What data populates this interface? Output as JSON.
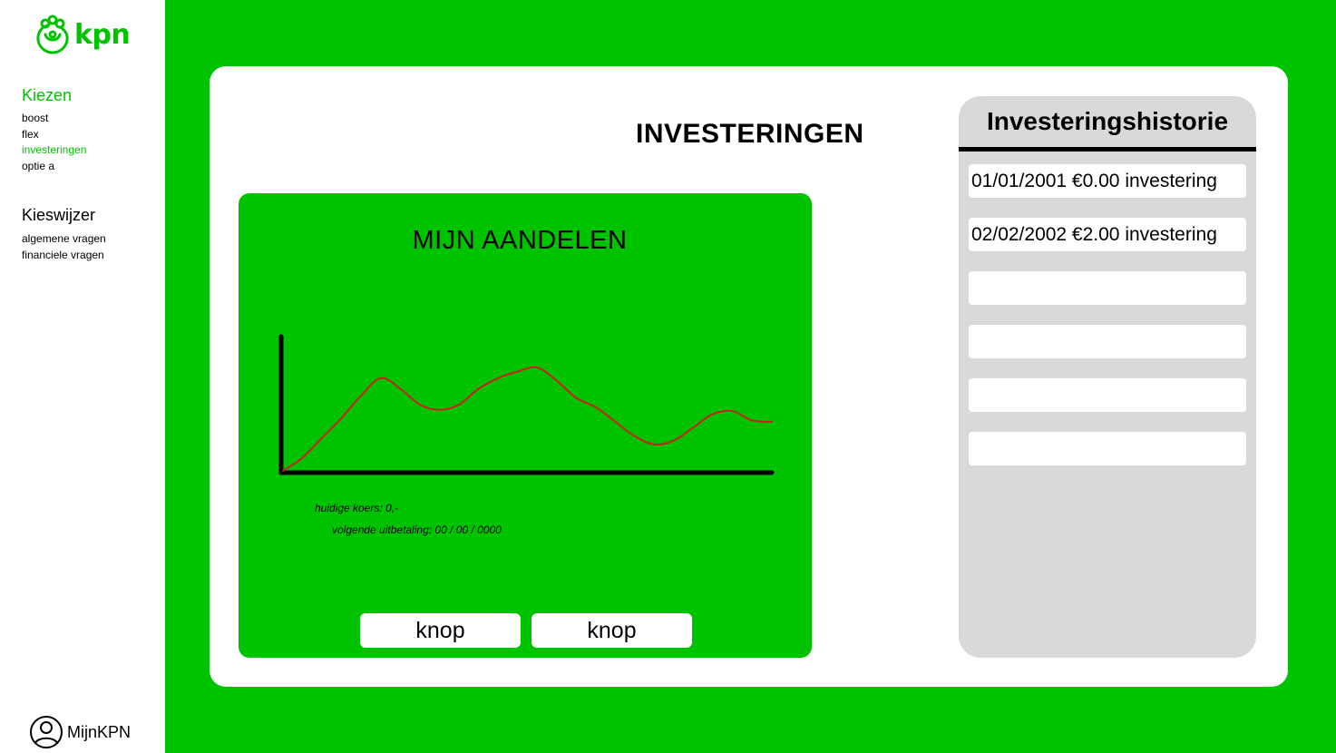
{
  "brand": {
    "name": "kpn",
    "color": "#00c300"
  },
  "sidebar": {
    "sections": [
      {
        "heading": "Kiezen",
        "items": [
          {
            "label": "boost",
            "active": false
          },
          {
            "label": "flex",
            "active": false
          },
          {
            "label": "investeringen",
            "active": true
          },
          {
            "label": "optie a",
            "active": false
          }
        ]
      },
      {
        "heading": "Kieswijzer",
        "items": [
          {
            "label": "algemene vragen",
            "active": false
          },
          {
            "label": "financiele vragen",
            "active": false
          }
        ]
      }
    ],
    "account_label": "MijnKPN"
  },
  "main": {
    "title": "INVESTERINGEN",
    "stocks": {
      "title": "MIJN AANDELEN",
      "current_rate": "huidige koers: 0,-",
      "next_payout": "volgende uitbetaling: 00 / 00 / 0000",
      "buttons": [
        "knop",
        "knop"
      ]
    },
    "history": {
      "title": "Investeringshistorie",
      "items": [
        "01/01/2001 €0.00 investering",
        "02/02/2002 €2.00 investering",
        "",
        "",
        "",
        ""
      ]
    }
  },
  "chart_data": {
    "type": "line",
    "title": "",
    "xlabel": "",
    "ylabel": "",
    "line_color": "#cc1f1f",
    "x": [
      0,
      1,
      2,
      3,
      4,
      5,
      6,
      7,
      8,
      9,
      10,
      11,
      12,
      13,
      14,
      15,
      16,
      17,
      18,
      19,
      20,
      21,
      22,
      23,
      24,
      25
    ],
    "values": [
      0,
      10,
      25,
      40,
      57,
      70,
      62,
      50,
      46,
      50,
      62,
      70,
      75,
      78,
      68,
      55,
      48,
      37,
      26,
      20,
      23,
      33,
      43,
      45,
      38,
      37
    ],
    "ylim": [
      0,
      100
    ],
    "grid": false,
    "legend": "none"
  }
}
